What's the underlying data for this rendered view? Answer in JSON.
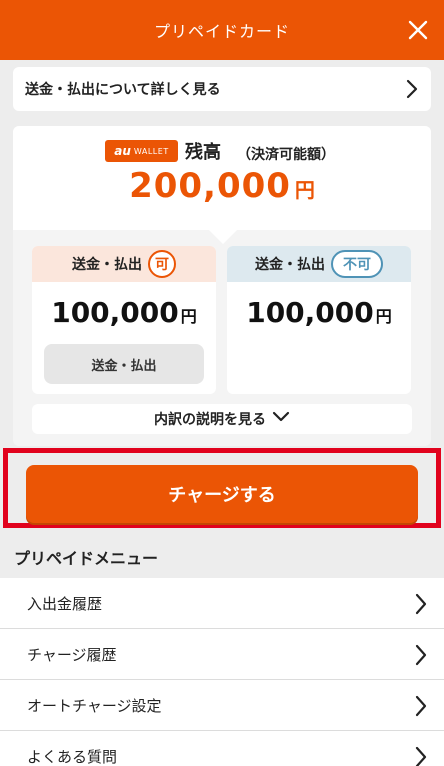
{
  "header": {
    "title": "プリペイドカード"
  },
  "link_box": {
    "label": "送金・払出について詳しく見る"
  },
  "balance": {
    "logo_au": "au",
    "logo_wallet": "WALLET",
    "label": "残高",
    "sub_label": "（決済可能額）",
    "amount": "200,000",
    "unit": "円"
  },
  "transferable": {
    "title": "送金・払出",
    "badge": "可",
    "amount": "100,000",
    "unit": "円",
    "button_label": "送金・払出"
  },
  "non_transferable": {
    "title": "送金・払出",
    "badge": "不可",
    "amount": "100,000",
    "unit": "円"
  },
  "breakdown_link": {
    "label": "内訳の説明を見る"
  },
  "charge_button": {
    "label": "チャージする"
  },
  "menu": {
    "title": "プリペイドメニュー",
    "items": [
      {
        "label": "入出金履歴"
      },
      {
        "label": "チャージ履歴"
      },
      {
        "label": "オートチャージ設定"
      },
      {
        "label": "よくある質問"
      }
    ]
  },
  "colors": {
    "accent": "#eb5505",
    "highlight_frame": "#e1021d",
    "non_transferable": "#4f93b6"
  }
}
